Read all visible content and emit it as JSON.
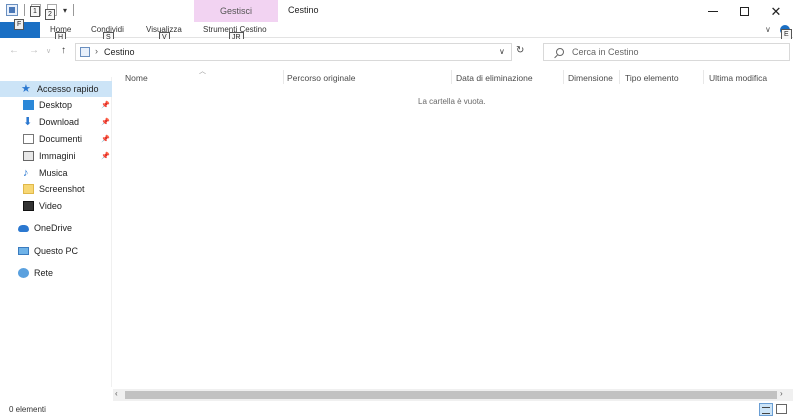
{
  "window": {
    "title": "Cestino",
    "context_tab": "Gestisci"
  },
  "ribbon": {
    "tabs": {
      "home": "Home",
      "share": "Condividi",
      "view": "Visualizza",
      "tools": "Strumenti Cestino"
    },
    "keytips": {
      "file": "F",
      "qat1": "1",
      "qat2": "2",
      "home": "H",
      "share": "S",
      "view": "V",
      "tools": "JR",
      "expand": "E"
    }
  },
  "address": {
    "path": "Cestino",
    "separator": "›"
  },
  "search": {
    "placeholder": "Cerca in Cestino"
  },
  "sidebar": {
    "items": [
      {
        "label": "Accesso rapido",
        "icon": "star-icon",
        "selected": true
      },
      {
        "label": "Desktop",
        "icon": "desktop-icon",
        "pinned": true
      },
      {
        "label": "Download",
        "icon": "download-icon",
        "pinned": true
      },
      {
        "label": "Documenti",
        "icon": "document-icon",
        "pinned": true
      },
      {
        "label": "Immagini",
        "icon": "pictures-icon",
        "pinned": true
      },
      {
        "label": "Musica",
        "icon": "music-icon"
      },
      {
        "label": "Screenshot",
        "icon": "folder-icon"
      },
      {
        "label": "Video",
        "icon": "video-icon"
      },
      {
        "label": "OneDrive",
        "icon": "cloud-icon"
      },
      {
        "label": "Questo PC",
        "icon": "computer-icon"
      },
      {
        "label": "Rete",
        "icon": "network-icon"
      }
    ]
  },
  "columns": {
    "name": "Nome",
    "original_path": "Percorso originale",
    "deleted_date": "Data di eliminazione",
    "size": "Dimensione",
    "type": "Tipo elemento",
    "modified": "Ultima modifica"
  },
  "content": {
    "empty_message": "La cartella è vuota."
  },
  "status": {
    "item_count": "0 elementi"
  },
  "colors": {
    "accent": "#1a6fc4",
    "context_tab": "#f2d3f2",
    "selection": "#cce4f7"
  }
}
